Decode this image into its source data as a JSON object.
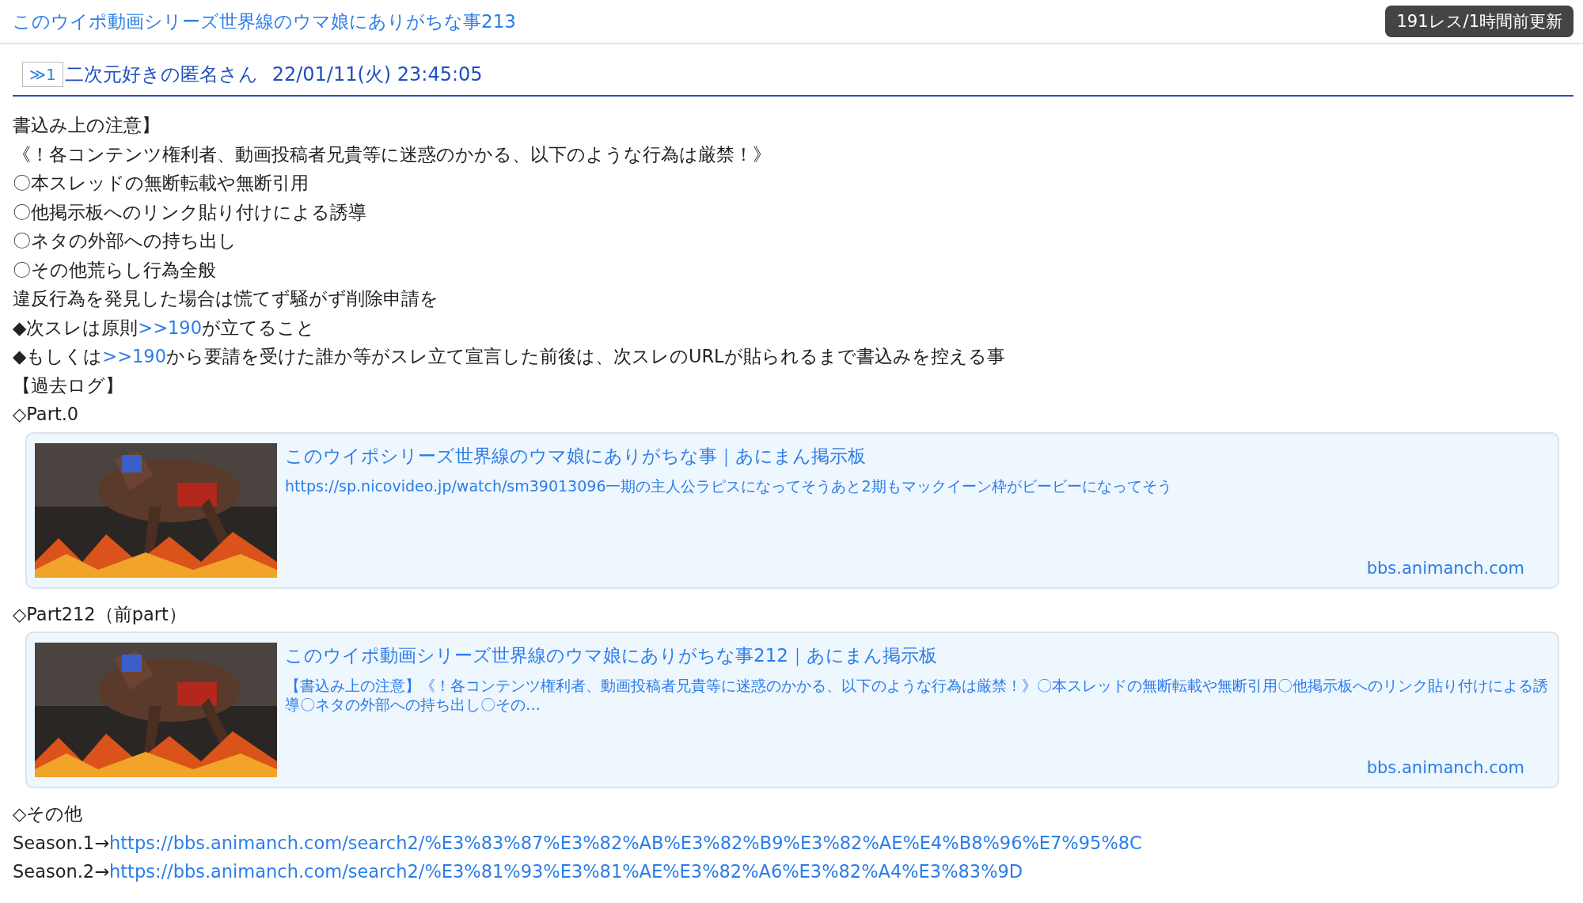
{
  "thread": {
    "title": "このウイポ動画シリーズ世界線のウマ娘にありがちな事213",
    "badge": "191レス/1時間前更新"
  },
  "post": {
    "number": "≫1",
    "author": "二次元好きの匿名さん",
    "date": "22/01/11(火) 23:45:05"
  },
  "body": [
    {
      "kind": "text",
      "parts": [
        {
          "text": "書込み上の注意】",
          "link": false
        }
      ]
    },
    {
      "kind": "text",
      "parts": [
        {
          "text": "《！各コンテンツ権利者、動画投稿者兄貴等に迷惑のかかる、以下のような行為は厳禁！》",
          "link": false
        }
      ]
    },
    {
      "kind": "text",
      "parts": [
        {
          "text": "〇本スレッドの無断転載や無断引用",
          "link": false
        }
      ]
    },
    {
      "kind": "text",
      "parts": [
        {
          "text": "〇他掲示板へのリンク貼り付けによる誘導",
          "link": false
        }
      ]
    },
    {
      "kind": "text",
      "parts": [
        {
          "text": "〇ネタの外部への持ち出し",
          "link": false
        }
      ]
    },
    {
      "kind": "text",
      "parts": [
        {
          "text": "〇その他荒らし行為全般",
          "link": false
        }
      ]
    },
    {
      "kind": "text",
      "parts": [
        {
          "text": "違反行為を発見した場合は慌てず騒がず削除申請を",
          "link": false
        }
      ]
    },
    {
      "kind": "text",
      "parts": [
        {
          "text": "◆次スレは原則",
          "link": false
        },
        {
          "text": ">>190",
          "link": true
        },
        {
          "text": "が立てること",
          "link": false
        }
      ]
    },
    {
      "kind": "text",
      "parts": [
        {
          "text": "◆もしくは",
          "link": false
        },
        {
          "text": ">>190",
          "link": true
        },
        {
          "text": "から要請を受けた誰か等がスレ立て宣言した前後は、次スレのURLが貼られるまで書込みを控える事",
          "link": false
        }
      ]
    },
    {
      "kind": "text",
      "parts": [
        {
          "text": "【過去ログ】",
          "link": false
        }
      ]
    },
    {
      "kind": "text",
      "parts": [
        {
          "text": "◇Part.0",
          "link": false
        }
      ]
    },
    {
      "kind": "card",
      "title": "このウイポシリーズ世界線のウマ娘にありがちな事｜あにまん掲示板",
      "description": "https://sp.nicovideo.jp/watch/sm39013096一期の主人公ラピスになってそうあと2期もマックイーン枠がビービーになってそう",
      "domain": "bbs.animanch.com"
    },
    {
      "kind": "text",
      "parts": [
        {
          "text": "◇Part212（前part）",
          "link": false
        }
      ]
    },
    {
      "kind": "card",
      "title": "このウイポ動画シリーズ世界線のウマ娘にありがちな事212｜あにまん掲示板",
      "description": "【書込み上の注意】《！各コンテンツ権利者、動画投稿者兄貴等に迷惑のかかる、以下のような行為は厳禁！》〇本スレッドの無断転載や無断引用〇他掲示板へのリンク貼り付けによる誘導〇ネタの外部への持ち出し〇その…",
      "domain": "bbs.animanch.com"
    },
    {
      "kind": "text",
      "parts": [
        {
          "text": "◇その他",
          "link": false
        }
      ]
    },
    {
      "kind": "text",
      "parts": [
        {
          "text": "Season.1→",
          "link": false
        },
        {
          "text": "https://bbs.animanch.com/search2/%E3%83%87%E3%82%AB%E3%82%B9%E3%82%AE%E4%B8%96%E7%95%8C",
          "link": true
        }
      ]
    },
    {
      "kind": "text",
      "parts": [
        {
          "text": "Season.2→",
          "link": false
        },
        {
          "text": "https://bbs.animanch.com/search2/%E3%81%93%E3%81%AE%E3%82%A6%E3%82%A4%E3%83%9D",
          "link": true
        }
      ]
    }
  ]
}
